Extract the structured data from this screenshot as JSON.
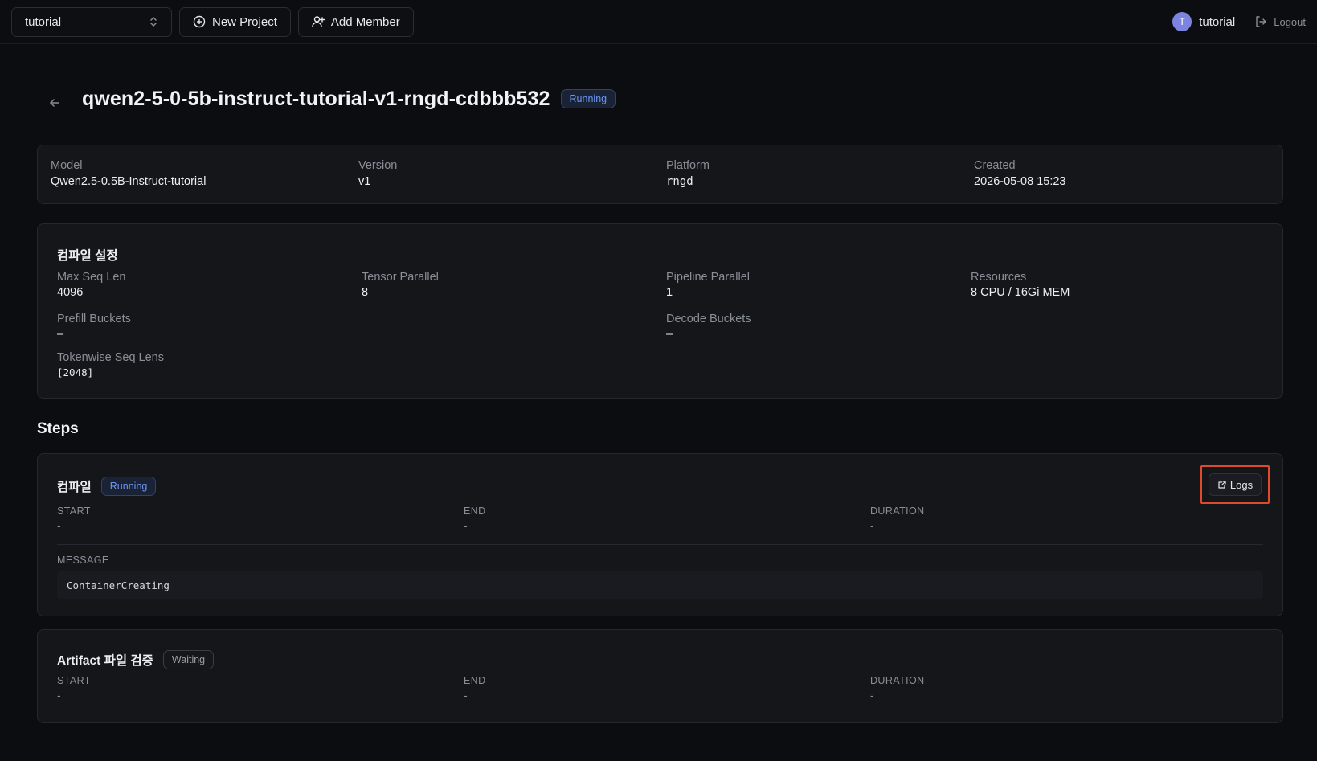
{
  "topbar": {
    "project": "tutorial",
    "new_project_label": "New Project",
    "add_member_label": "Add Member",
    "avatar_initial": "T",
    "username": "tutorial",
    "logout_label": "Logout"
  },
  "header": {
    "title": "qwen2-5-0-5b-instruct-tutorial-v1-rngd-cdbbb532",
    "status": "Running"
  },
  "info": {
    "model_label": "Model",
    "model": "Qwen2.5-0.5B-Instruct-tutorial",
    "version_label": "Version",
    "version": "v1",
    "platform_label": "Platform",
    "platform": "rngd",
    "created_label": "Created",
    "created": "2026-05-08 15:23"
  },
  "compile": {
    "title": "컴파일 설정",
    "max_seq_len_label": "Max Seq Len",
    "max_seq_len": "4096",
    "tensor_parallel_label": "Tensor Parallel",
    "tensor_parallel": "8",
    "pipeline_parallel_label": "Pipeline Parallel",
    "pipeline_parallel": "1",
    "resources_label": "Resources",
    "resources": "8 CPU / 16Gi MEM",
    "prefill_buckets_label": "Prefill Buckets",
    "prefill_buckets": "–",
    "decode_buckets_label": "Decode Buckets",
    "decode_buckets": "–",
    "tokenwise_label": "Tokenwise Seq Lens",
    "tokenwise": "[2048]"
  },
  "steps": {
    "title": "Steps",
    "items": [
      {
        "name": "컴파일",
        "status": "Running",
        "start_label": "START",
        "start": "-",
        "end_label": "END",
        "end": "-",
        "duration_label": "DURATION",
        "duration": "-",
        "message_label": "MESSAGE",
        "message": "ContainerCreating",
        "logs_label": "Logs"
      },
      {
        "name": "Artifact 파일 검증",
        "status": "Waiting",
        "start_label": "START",
        "start": "-",
        "end_label": "END",
        "end": "-",
        "duration_label": "DURATION",
        "duration": "-"
      }
    ]
  },
  "colors": {
    "background": "#0c0d10",
    "card": "#14161a",
    "running": "#6e95f1",
    "highlight": "#e04a2c",
    "avatar": "#7c83e0"
  }
}
